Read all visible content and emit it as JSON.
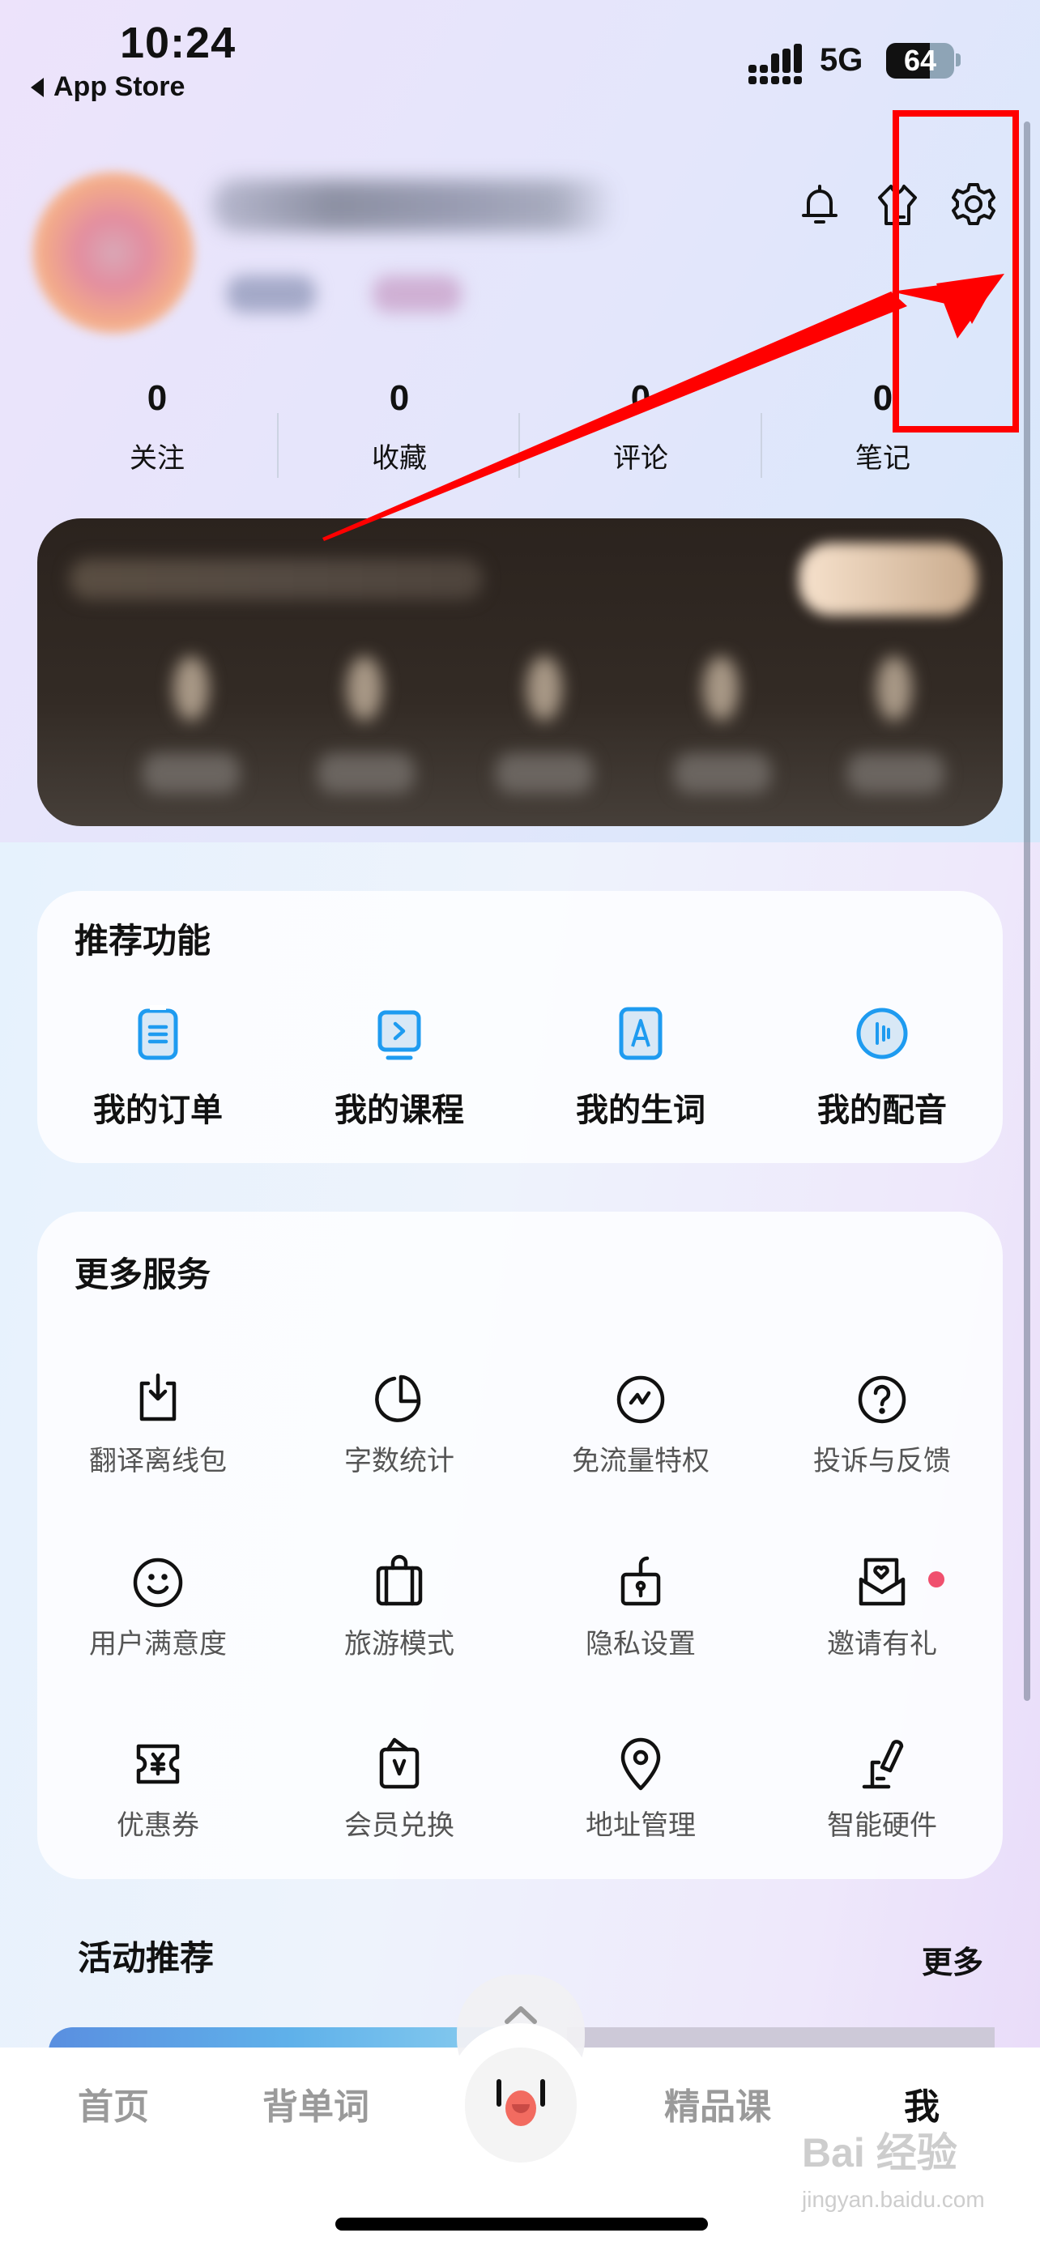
{
  "status_bar": {
    "time": "10:24",
    "back_app": "App Store",
    "network": "5G",
    "battery": "64",
    "battery_percent": 64
  },
  "header": {
    "icons": [
      "bell-icon",
      "shirt-icon",
      "gear-icon"
    ]
  },
  "stats": [
    {
      "value": "0",
      "label": "关注"
    },
    {
      "value": "0",
      "label": "收藏"
    },
    {
      "value": "0",
      "label": "评论"
    },
    {
      "value": "0",
      "label": "笔记"
    }
  ],
  "recommended": {
    "title": "推荐功能",
    "items": [
      {
        "label": "我的订单",
        "icon": "order-list-icon"
      },
      {
        "label": "我的课程",
        "icon": "course-play-icon"
      },
      {
        "label": "我的生词",
        "icon": "vocabulary-a-icon"
      },
      {
        "label": "我的配音",
        "icon": "dubbing-audio-icon"
      }
    ]
  },
  "services": {
    "title": "更多服务",
    "items": [
      {
        "label": "翻译离线包",
        "icon": "download-icon"
      },
      {
        "label": "字数统计",
        "icon": "pie-chart-icon"
      },
      {
        "label": "免流量特权",
        "icon": "traffic-icon"
      },
      {
        "label": "投诉与反馈",
        "icon": "question-icon"
      },
      {
        "label": "用户满意度",
        "icon": "smile-icon"
      },
      {
        "label": "旅游模式",
        "icon": "suitcase-icon"
      },
      {
        "label": "隐私设置",
        "icon": "lock-icon"
      },
      {
        "label": "邀请有礼",
        "icon": "invite-envelope-icon",
        "badge": true
      },
      {
        "label": "优惠券",
        "icon": "coupon-icon"
      },
      {
        "label": "会员兑换",
        "icon": "vip-exchange-icon"
      },
      {
        "label": "地址管理",
        "icon": "location-icon"
      },
      {
        "label": "智能硬件",
        "icon": "smart-pen-icon"
      }
    ]
  },
  "activities": {
    "title": "活动推荐",
    "more": "更多"
  },
  "tabbar": {
    "tabs": [
      {
        "label": "首页",
        "active": false
      },
      {
        "label": "背单词",
        "active": false
      },
      {
        "label": "精品课",
        "active": false
      },
      {
        "label": "我",
        "active": true
      }
    ]
  },
  "watermark": {
    "brand": "Bai 经验",
    "url": "jingyan.baidu.com"
  },
  "colors": {
    "accent_blue": "#1e9bf0",
    "badge_red": "#f0506e",
    "annotation_red": "#ff0000"
  }
}
